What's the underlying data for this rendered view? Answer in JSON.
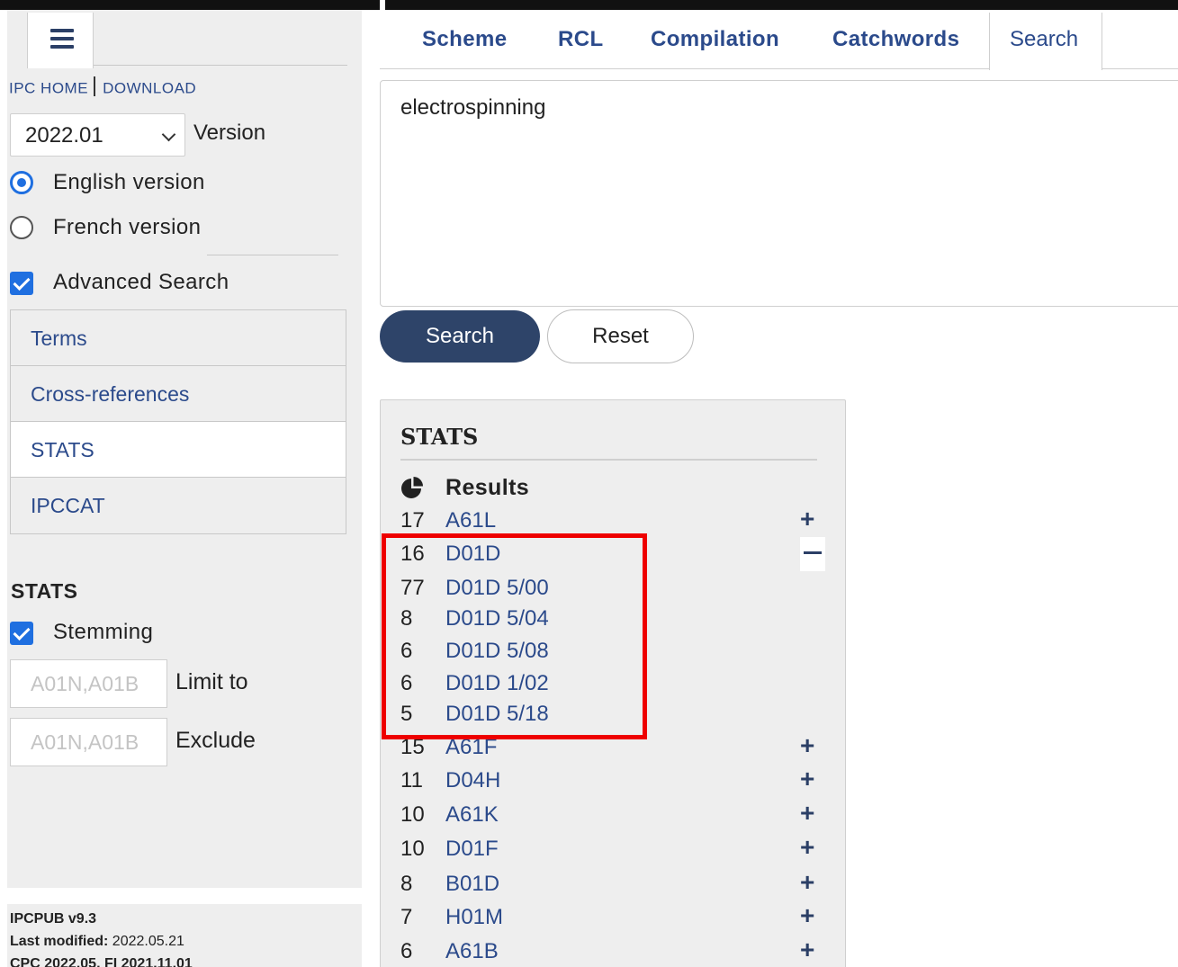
{
  "sidebar": {
    "links": {
      "home": "IPC HOME",
      "download": "DOWNLOAD"
    },
    "version": {
      "selected": "2022.01",
      "label": "Version"
    },
    "language": {
      "english": "English version",
      "french": "French version"
    },
    "advanced_search": "Advanced Search",
    "nav": [
      "Terms",
      "Cross-references",
      "STATS",
      "IPCCAT"
    ],
    "stats": {
      "title": "STATS",
      "stemming": "Stemming",
      "limit_placeholder": "A01N,A01B",
      "limit_label": "Limit to",
      "exclude_placeholder": "A01N,A01B",
      "exclude_label": "Exclude"
    },
    "footer": {
      "version": "IPCPUB v9.3",
      "modified_label": "Last modified:",
      "modified_value": "2022.05.21",
      "cpc": "CPC 2022.05, FI 2021.11.01"
    }
  },
  "tabs": {
    "scheme": "Scheme",
    "rcl": "RCL",
    "compilation": "Compilation",
    "catchwords": "Catchwords",
    "search": "Search"
  },
  "query": "electrospinning",
  "buttons": {
    "search": "Search",
    "reset": "Reset"
  },
  "stats_panel": {
    "title": "STATS",
    "results_label": "Results",
    "rows": [
      {
        "count": "17",
        "code": "A61L",
        "toggle": "+"
      },
      {
        "count": "16",
        "code": "D01D",
        "toggle": "-"
      },
      {
        "count": "77",
        "code": "D01D 5/00",
        "toggle": ""
      },
      {
        "count": "8",
        "code": "D01D 5/04",
        "toggle": ""
      },
      {
        "count": "6",
        "code": "D01D 5/08",
        "toggle": ""
      },
      {
        "count": "6",
        "code": "D01D 1/02",
        "toggle": ""
      },
      {
        "count": "5",
        "code": "D01D 5/18",
        "toggle": ""
      },
      {
        "count": "15",
        "code": "A61F",
        "toggle": "+"
      },
      {
        "count": "11",
        "code": "D04H",
        "toggle": "+"
      },
      {
        "count": "10",
        "code": "A61K",
        "toggle": "+"
      },
      {
        "count": "10",
        "code": "D01F",
        "toggle": "+"
      },
      {
        "count": "8",
        "code": "B01D",
        "toggle": "+"
      },
      {
        "count": "7",
        "code": "H01M",
        "toggle": "+"
      },
      {
        "count": "6",
        "code": "A61B",
        "toggle": "+"
      }
    ]
  },
  "colors": {
    "accent": "#2e4469",
    "link": "#2b4a8b",
    "highlight": "#ee0000",
    "checkbox": "#1f6fe0"
  },
  "icons": [
    "hamburger-menu-icon",
    "chevron-down-icon",
    "pie-chart-icon",
    "plus-icon",
    "minus-icon"
  ]
}
